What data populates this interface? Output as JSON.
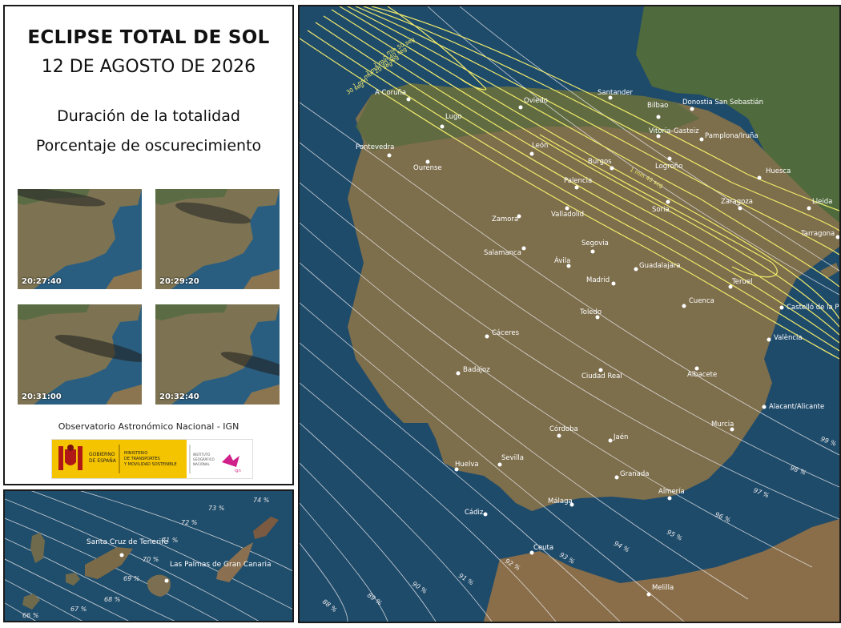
{
  "legend": {
    "title": "ECLIPSE TOTAL DE SOL",
    "date": "12 DE AGOSTO DE 2026",
    "line1": "Duración de la totalidad",
    "line2": "Porcentaje de oscurecimiento",
    "thumbnails": [
      "20:27:40",
      "20:29:20",
      "20:31:00",
      "20:32:40"
    ],
    "observatory": "Observatorio Astronómico Nacional - IGN",
    "logos": {
      "gobierno": "GOBIERNO DE ESPAÑA",
      "ministerio": "MINISTERIO DE TRANSPORTES Y MOVILIDAD SOSTENIBLE",
      "instituto": "INSTITUTO GEOGRÁFICO NACIONAL"
    }
  },
  "canary": {
    "cities": [
      "Santa Cruz de Tenerife",
      "Las Palmas de Gran Canaria"
    ],
    "percent_labels": [
      "74 %",
      "73 %",
      "72 %",
      "71 %",
      "70 %",
      "69 %",
      "68 %",
      "67 %",
      "66 %"
    ]
  },
  "mainmap": {
    "duration_labels": [
      "1 min 50 seg",
      "1 min 40 seg",
      "1 min 30 seg",
      "1 min 20 seg",
      "1 min",
      "30 seg",
      "1 min 40 seg"
    ],
    "percent_labels": [
      "99 %",
      "98 %",
      "97 %",
      "96 %",
      "95 %",
      "94 %",
      "93 %",
      "92 %",
      "91 %",
      "90 %",
      "89 %",
      "88 %"
    ],
    "cities": [
      "A Coruña",
      "Oviedo",
      "Santander",
      "Bilbao",
      "Donostia San Sebastián",
      "Lugo",
      "Vitoria-Gasteiz",
      "Pamplona/Iruña",
      "Pontevedra",
      "León",
      "Ourense",
      "Burgos",
      "Logroño",
      "Huesca",
      "Palencia",
      "Zaragoza",
      "Lleida",
      "Zamora",
      "Valladolid",
      "Soria",
      "Tarragona",
      "Salamanca",
      "Segovia",
      "Ávila",
      "Guadalajara",
      "Madrid",
      "Teruel",
      "Cuenca",
      "Castelló de la Plana",
      "Toledo",
      "Cáceres",
      "València",
      "Badajoz",
      "Ciudad Real",
      "Albacete",
      "Alacant/Alicante",
      "Murcia",
      "Córdoba",
      "Jaén",
      "Huelva",
      "Sevilla",
      "Granada",
      "Almería",
      "Málaga",
      "Cádiz",
      "Ceuta",
      "Melilla"
    ]
  },
  "colors": {
    "path_line": "#f2ec6a",
    "percent_line": "#e8e8e8",
    "land": "#8a7a56",
    "sea": "#1e4a6a"
  }
}
